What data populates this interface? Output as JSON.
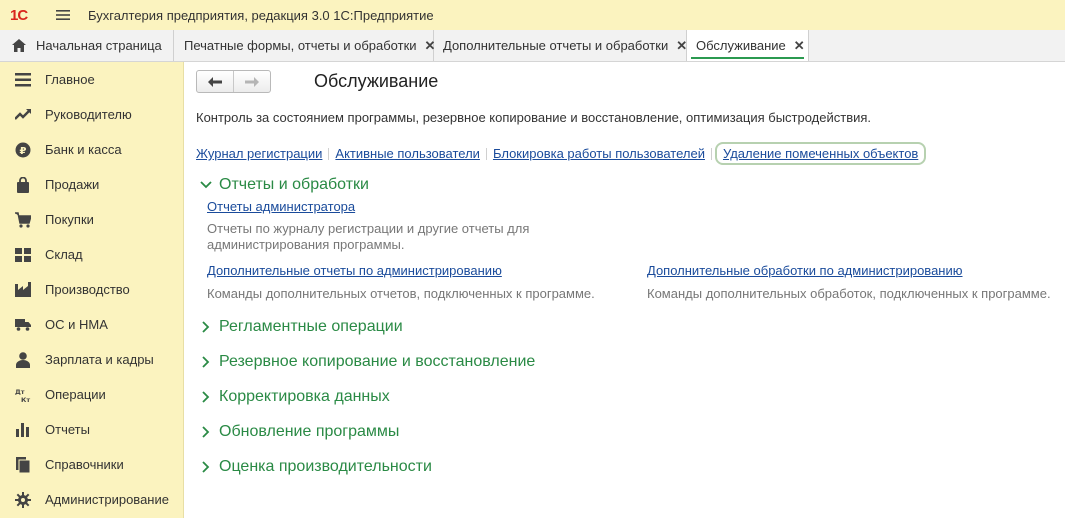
{
  "app": {
    "logo_text": "1С",
    "title": "Бухгалтерия предприятия, редакция 3.0 1С:Предприятие"
  },
  "tabs": [
    {
      "label": "Начальная страница"
    },
    {
      "label": "Печатные формы, отчеты и обработки",
      "close": "✕"
    },
    {
      "label": "Дополнительные отчеты и обработки",
      "close": "✕"
    },
    {
      "label": "Обслуживание",
      "close": "✕",
      "active": true
    }
  ],
  "sidebar": {
    "items": [
      {
        "label": "Главное",
        "icon": "menu-lines-icon"
      },
      {
        "label": "Руководителю",
        "icon": "trend-icon"
      },
      {
        "label": "Банк и касса",
        "icon": "ruble-coin-icon"
      },
      {
        "label": "Продажи",
        "icon": "bag-icon"
      },
      {
        "label": "Покупки",
        "icon": "cart-icon"
      },
      {
        "label": "Склад",
        "icon": "warehouse-icon"
      },
      {
        "label": "Производство",
        "icon": "factory-icon"
      },
      {
        "label": "ОС и НМА",
        "icon": "truck-icon"
      },
      {
        "label": "Зарплата и кадры",
        "icon": "person-icon"
      },
      {
        "label": "Операции",
        "icon": "dt-kt-icon",
        "icon_text": "Дт Кт"
      },
      {
        "label": "Отчеты",
        "icon": "bar-chart-icon"
      },
      {
        "label": "Справочники",
        "icon": "books-icon"
      },
      {
        "label": "Администрирование",
        "icon": "gear-icon"
      }
    ]
  },
  "page": {
    "title": "Обслуживание",
    "description": "Контроль за состоянием программы, резервное копирование и восстановление, оптимизация быстродействия.",
    "links": [
      "Журнал регистрации",
      "Активные пользователи",
      "Блокировка работы пользователей",
      "Удаление помеченных объектов"
    ],
    "sections": [
      {
        "title": "Отчеты и обработки",
        "expanded": true,
        "items": [
          {
            "link": "Отчеты администратора",
            "text": "Отчеты по журналу регистрации и другие отчеты для администрирования программы."
          },
          {
            "link": "Дополнительные отчеты по администрированию",
            "text": "Команды дополнительных отчетов, подключенных к программе."
          },
          {
            "link": "Дополнительные обработки по администрированию",
            "text": "Команды дополнительных обработок, подключенных к программе."
          }
        ]
      },
      {
        "title": "Регламентные операции",
        "expanded": false
      },
      {
        "title": "Резервное копирование и восстановление",
        "expanded": false
      },
      {
        "title": "Корректировка данных",
        "expanded": false
      },
      {
        "title": "Обновление программы",
        "expanded": false
      },
      {
        "title": "Оценка производительности",
        "expanded": false
      }
    ]
  },
  "colors": {
    "accent_green": "#2a8a45",
    "link_blue": "#1a4b9b",
    "panel_yellow": "#fbf3bf"
  }
}
